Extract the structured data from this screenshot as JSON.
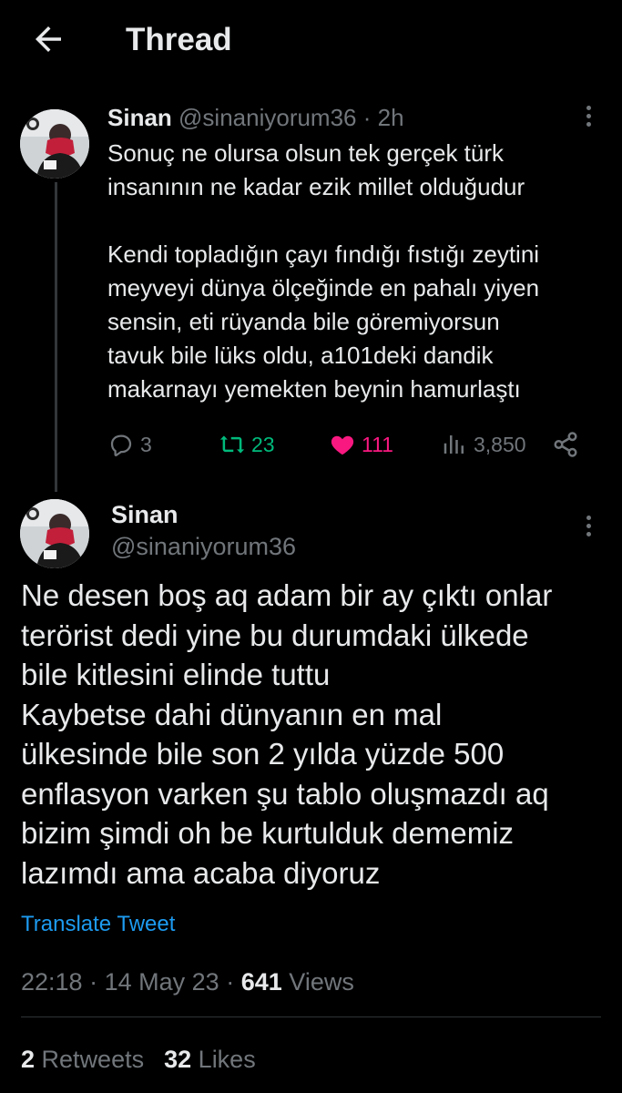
{
  "header": {
    "title": "Thread"
  },
  "parent_tweet": {
    "name": "Sinan",
    "handle": "@sinaniyorum36",
    "separator": "·",
    "time": "2h",
    "text": "Sonuç ne olursa olsun tek gerçek türk\ninsanının ne kadar ezik millet olduğudur\n\nKendi topladığın çayı fındığı fıstığı zeytini\nmeyveyi dünya ölçeğinde en pahalı yiyen\nsensin, eti rüyanda bile göremiyorsun\ntavuk bile lüks oldu, a101deki dandik\nmakarnayı yemekten beynin hamurlaştı",
    "replies": "3",
    "retweets": "23",
    "likes": "111",
    "views": "3,850"
  },
  "main_tweet": {
    "name": "Sinan",
    "handle": "@sinaniyorum36",
    "text": "Ne desen boş aq adam bir ay çıktı onlar\nterörist dedi yine bu durumdaki ülkede\nbile kitlesini elinde tuttu\nKaybetse dahi dünyanın en mal\nülkesinde bile son 2 yılda yüzde 500\nenflasyon varken şu tablo oluşmazdı aq\nbizim şimdi oh be kurtulduk dememiz\nlazımdı ama acaba diyoruz",
    "translate_label": "Translate Tweet",
    "time": "22:18",
    "date": "14 May 23",
    "separator": "·",
    "views_count": "641",
    "views_label": "Views",
    "retweets_count": "2",
    "retweets_label": "Retweets",
    "likes_count": "32",
    "likes_label": "Likes"
  },
  "colors": {
    "background": "#000000",
    "text_primary": "#e7e9ea",
    "text_muted": "#71767b",
    "retweet_green": "#00ba7c",
    "like_pink": "#f91880",
    "link_blue": "#1d9bf0"
  },
  "icons": [
    "back-arrow-icon",
    "more-icon",
    "reply-icon",
    "retweet-icon",
    "heart-icon",
    "views-icon",
    "share-icon"
  ]
}
